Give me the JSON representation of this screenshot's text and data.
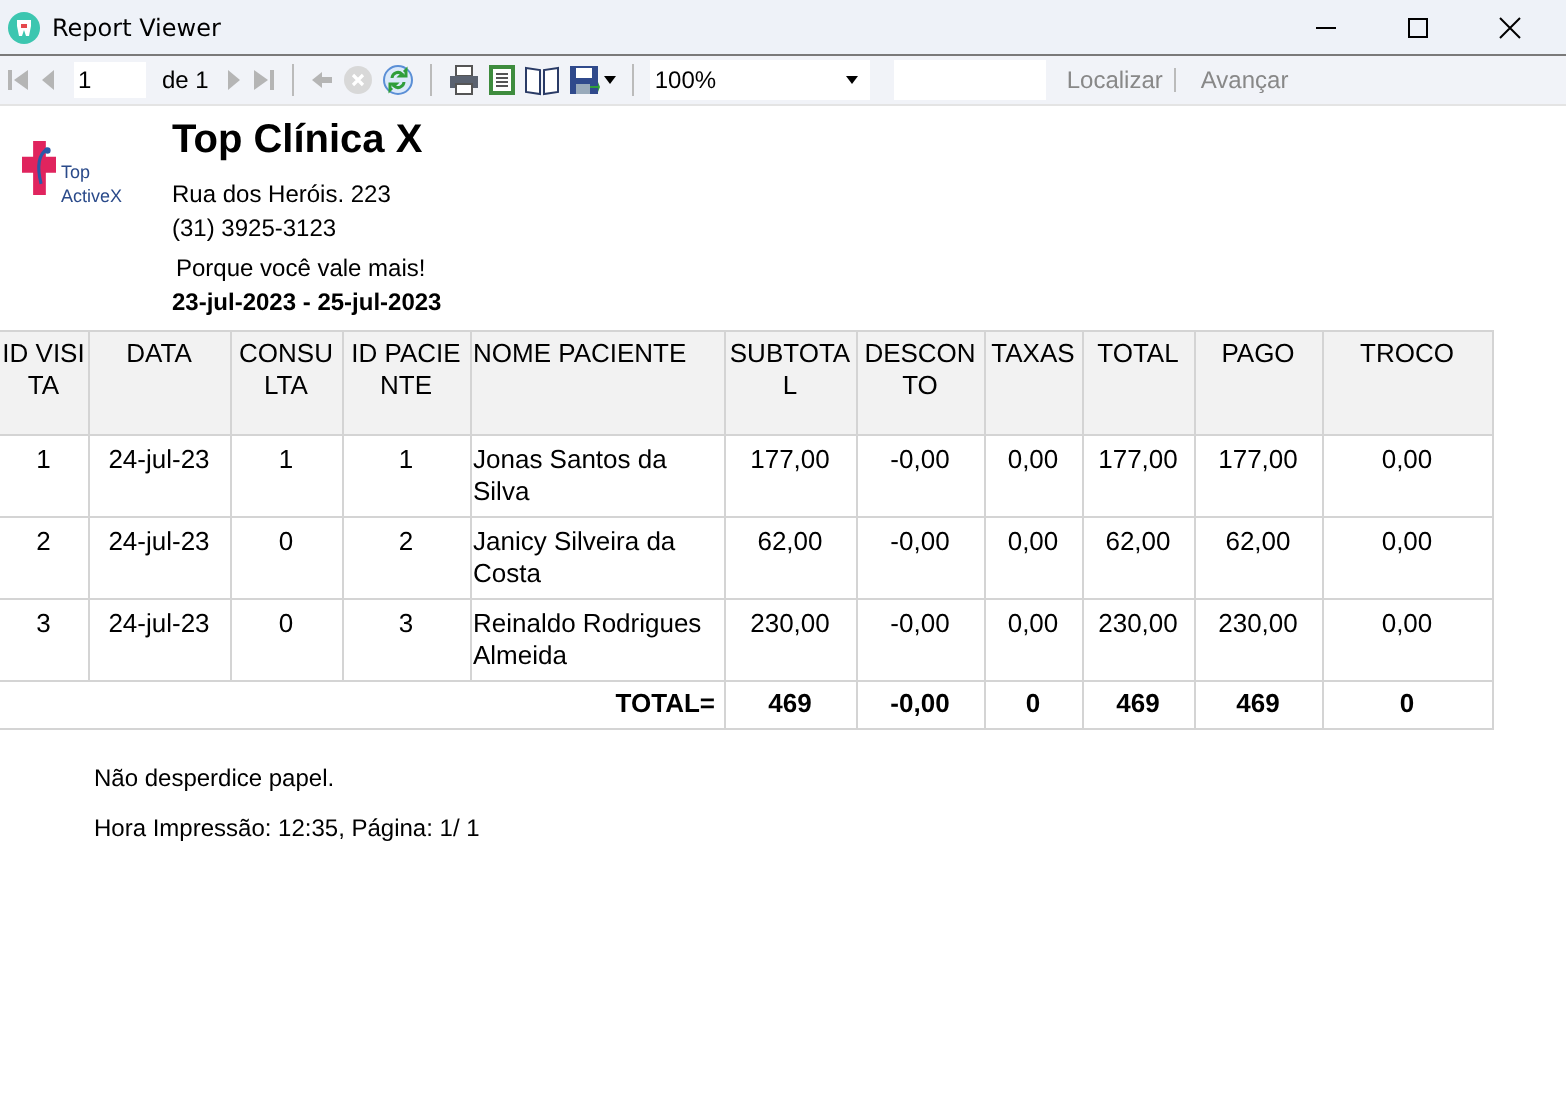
{
  "window": {
    "title": "Report Viewer"
  },
  "toolbar": {
    "buttons": [
      {
        "kind": "first",
        "disabled": true
      },
      {
        "kind": "prev",
        "disabled": true
      },
      {
        "kind": "page",
        "value": "1"
      },
      {
        "kind": "of",
        "label": "de 1"
      },
      {
        "kind": "next",
        "disabled": true
      },
      {
        "kind": "last",
        "disabled": true
      },
      {
        "kind": "sep"
      },
      {
        "kind": "back",
        "disabled": true
      },
      {
        "kind": "stop",
        "disabled": true
      },
      {
        "kind": "refresh",
        "disabled": false
      },
      {
        "kind": "sep"
      },
      {
        "kind": "print",
        "disabled": false
      },
      {
        "kind": "layout",
        "disabled": false
      },
      {
        "kind": "setup",
        "disabled": false
      },
      {
        "kind": "save",
        "disabled": false
      },
      {
        "kind": "sep"
      },
      {
        "kind": "zoom",
        "value": "100%"
      },
      {
        "kind": "find"
      },
      {
        "kind": "link",
        "label": "Localizar",
        "disabled": true
      },
      {
        "kind": "linksep"
      },
      {
        "kind": "link",
        "label": "Avançar",
        "disabled": true
      }
    ]
  },
  "report": {
    "logo_text": [
      "Top",
      "ActiveX"
    ],
    "title": "Top Clínica X",
    "address": "Rua dos Heróis. 223",
    "phone": "(31) 3925-3123",
    "slogan": "Porque você vale mais!",
    "period": "23-jul-2023 - 25-jul-2023",
    "table": {
      "columns": [
        "ID VISITA",
        "DATA",
        "CONSULTA",
        "ID PACIENTE",
        "NOME PACIENTE",
        "SUBTOTAL",
        "DESCONTO",
        "TAXAS",
        "TOTAL",
        "PAGO",
        "TROCO"
      ],
      "rows": [
        [
          "1",
          "24-jul-23",
          "1",
          "1",
          "Jonas Santos da Silva",
          "177,00",
          "-0,00",
          "0,00",
          "177,00",
          "177,00",
          "0,00"
        ],
        [
          "2",
          "24-jul-23",
          "0",
          "2",
          "Janicy Silveira da Costa",
          "62,00",
          "-0,00",
          "0,00",
          "62,00",
          "62,00",
          "0,00"
        ],
        [
          "3",
          "24-jul-23",
          "0",
          "3",
          "Reinaldo Rodrigues Almeida",
          "230,00",
          "-0,00",
          "0,00",
          "230,00",
          "230,00",
          "0,00"
        ]
      ],
      "total_label": "TOTAL=",
      "totals": [
        "469",
        "-0,00",
        "0",
        "469",
        "469",
        "0"
      ]
    },
    "footer": [
      "Não desperdice papel.",
      "Hora Impressão: 12:35, Página: 1/ 1"
    ]
  }
}
